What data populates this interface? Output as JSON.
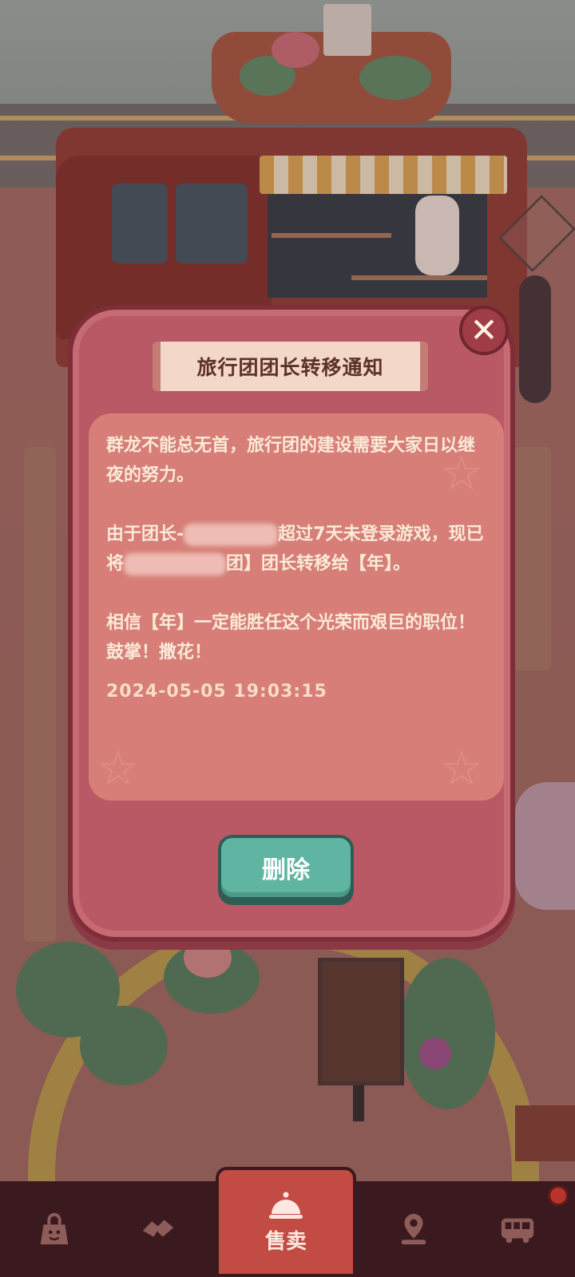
{
  "dialog": {
    "title": "旅行团团长转移通知",
    "close_symbol": "✕",
    "paragraphs": [
      "群龙不能总无首，旅行团的建设需要大家日以继夜的努力。",
      "由于团长-",
      "超过7天未登录游戏，现已将",
      "团】团长转移给【年】。",
      "相信【年】一定能胜任这个光荣而艰巨的职位！鼓掌！撒花！"
    ],
    "timestamp": "2024-05-05 19:03:15",
    "delete_label": "删除"
  },
  "nav": {
    "active_label": "售卖",
    "items": [
      "bag-icon",
      "handshake-icon",
      "cloche-icon",
      "map-pin-icon",
      "bus-icon"
    ]
  },
  "colors": {
    "dialog_bg": "#b95965",
    "content_bg": "#d67e77",
    "delete_button": "#5fb5a2",
    "nav_active": "#c24b43",
    "nav_bg": "#3b1a1f"
  }
}
